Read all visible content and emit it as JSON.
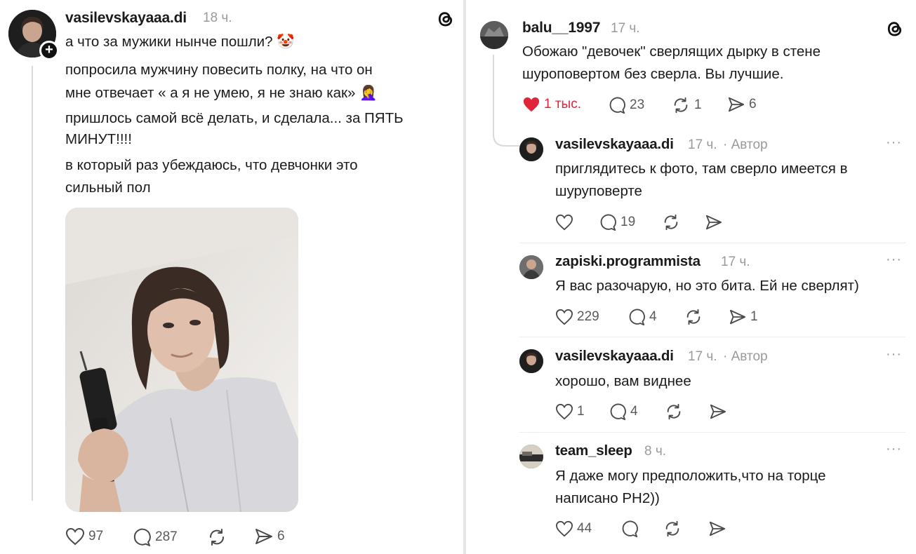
{
  "post": {
    "username": "vasilevskayaaa.di",
    "time": "18 ч.",
    "lines": [
      "а что за мужики нынче пошли? 🤡",
      "попросила мужчину повесить полку, на что он",
      "мне отвечает « а я не умею, я не знаю как» 🤦‍♀️",
      "пришлось самой всё делать, и сделала... за ПЯТЬ",
      "МИНУТ!!!!",
      "в который раз убеждаюсь, что девчонки это",
      "сильный пол"
    ],
    "likes": "97",
    "comments": "287",
    "shares": "6"
  },
  "reply": {
    "username": "balu__1997",
    "time": "17 ч.",
    "lines": [
      "Обожаю \"девочек\" сверлящих дырку в стене",
      "шуроповертом без сверла. Вы лучшие."
    ],
    "likes": "1 тыс.",
    "comments": "23",
    "reposts": "1",
    "shares": "6"
  },
  "comments": [
    {
      "username": "vasilevskayaaa.di",
      "time": "17 ч.",
      "author": "· Автор",
      "lines": [
        "приглядитесь к фото, там сверло имеется в",
        "шуруповерте"
      ],
      "likes": "",
      "comments": "19",
      "shares": ""
    },
    {
      "username": "zapiski.programmista",
      "time": "17 ч.",
      "author": "",
      "lines": [
        "Я вас разочарую, но это бита. Ей не сверлят)"
      ],
      "likes": "229",
      "comments": "4",
      "shares": "1"
    },
    {
      "username": "vasilevskayaaa.di",
      "time": "17 ч.",
      "author": "· Автор",
      "lines": [
        "хорошо, вам виднее"
      ],
      "likes": "1",
      "comments": "4",
      "shares": ""
    },
    {
      "username": "team_sleep",
      "time": "8 ч.",
      "author": "",
      "lines": [
        "Я даже могу предположить,что на торце",
        "написано PH2))"
      ],
      "likes": "44",
      "comments": "",
      "shares": ""
    }
  ],
  "more_glyph": "···",
  "colors": {
    "like_active": "#e0243a",
    "meta_gray": "#9a9a9a",
    "icon_gray": "#4a4a4a"
  }
}
